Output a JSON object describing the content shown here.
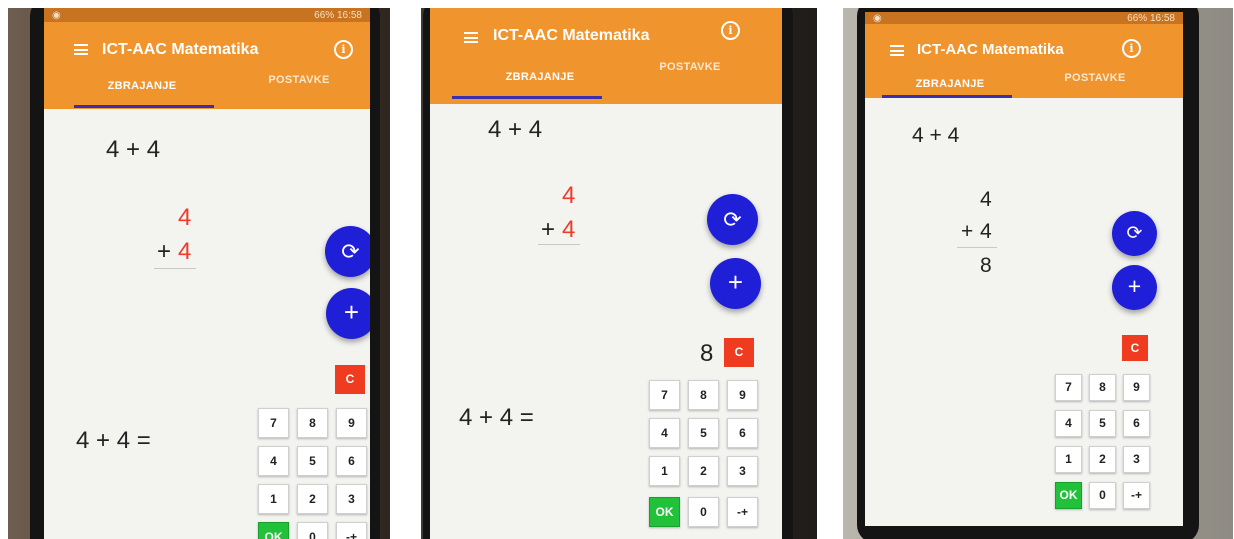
{
  "app": {
    "title": "ICT-AAC Matematika",
    "tabs": [
      "ZBRAJANJE",
      "POSTAVKE"
    ],
    "status_battery": "66%",
    "status_time": "16:58",
    "colors": {
      "appbar": "#f0942e",
      "fab": "#1f1fd8",
      "ok": "#21c13a",
      "clear": "#ef3b1f",
      "digit_red": "#ef3b2a"
    }
  },
  "icons": {
    "menu": "hamburger-menu-icon",
    "info": "info-circle-icon",
    "refresh": "refresh-icon",
    "add": "plus-icon"
  },
  "screens": [
    {
      "problem": "4 + 4",
      "top_operand": "4",
      "plus_sign": "+",
      "bottom_operand": "4",
      "result": "",
      "typed_answer": "",
      "equation_prompt": "4 + 4 =",
      "fab_add": "+",
      "clear_key": "C",
      "keypad": [
        "7",
        "8",
        "9",
        "4",
        "5",
        "6",
        "1",
        "2",
        "3",
        "OK",
        "0",
        "-+"
      ]
    },
    {
      "problem": "4 + 4",
      "top_operand": "4",
      "plus_sign": "+",
      "bottom_operand": "4",
      "result": "",
      "typed_answer": "8",
      "equation_prompt": "4 + 4 =",
      "fab_add": "+",
      "clear_key": "C",
      "keypad": [
        "7",
        "8",
        "9",
        "4",
        "5",
        "6",
        "1",
        "2",
        "3",
        "OK",
        "0",
        "-+"
      ]
    },
    {
      "problem": "4 + 4",
      "top_operand": "4",
      "plus_sign": "+",
      "bottom_operand": "4",
      "result": "8",
      "typed_answer": "",
      "equation_prompt": "",
      "fab_add": "+",
      "clear_key": "C",
      "keypad": [
        "7",
        "8",
        "9",
        "4",
        "5",
        "6",
        "1",
        "2",
        "3",
        "OK",
        "0",
        "-+"
      ]
    }
  ]
}
